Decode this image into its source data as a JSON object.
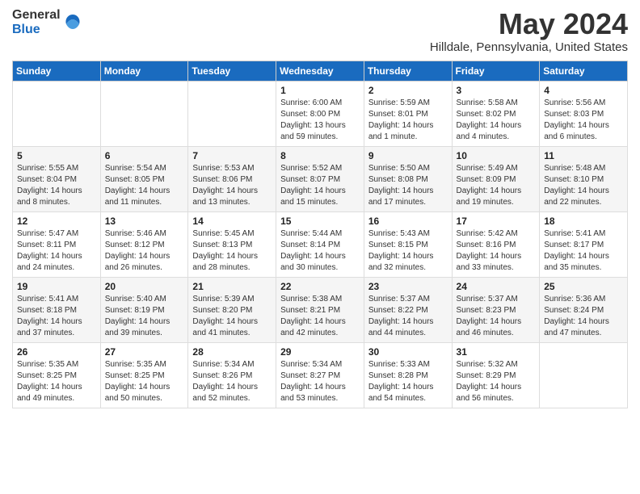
{
  "logo": {
    "general": "General",
    "blue": "Blue"
  },
  "title": "May 2024",
  "subtitle": "Hilldale, Pennsylvania, United States",
  "days_of_week": [
    "Sunday",
    "Monday",
    "Tuesday",
    "Wednesday",
    "Thursday",
    "Friday",
    "Saturday"
  ],
  "weeks": [
    [
      {
        "day": "",
        "info": ""
      },
      {
        "day": "",
        "info": ""
      },
      {
        "day": "",
        "info": ""
      },
      {
        "day": "1",
        "info": "Sunrise: 6:00 AM\nSunset: 8:00 PM\nDaylight: 13 hours\nand 59 minutes."
      },
      {
        "day": "2",
        "info": "Sunrise: 5:59 AM\nSunset: 8:01 PM\nDaylight: 14 hours\nand 1 minute."
      },
      {
        "day": "3",
        "info": "Sunrise: 5:58 AM\nSunset: 8:02 PM\nDaylight: 14 hours\nand 4 minutes."
      },
      {
        "day": "4",
        "info": "Sunrise: 5:56 AM\nSunset: 8:03 PM\nDaylight: 14 hours\nand 6 minutes."
      }
    ],
    [
      {
        "day": "5",
        "info": "Sunrise: 5:55 AM\nSunset: 8:04 PM\nDaylight: 14 hours\nand 8 minutes."
      },
      {
        "day": "6",
        "info": "Sunrise: 5:54 AM\nSunset: 8:05 PM\nDaylight: 14 hours\nand 11 minutes."
      },
      {
        "day": "7",
        "info": "Sunrise: 5:53 AM\nSunset: 8:06 PM\nDaylight: 14 hours\nand 13 minutes."
      },
      {
        "day": "8",
        "info": "Sunrise: 5:52 AM\nSunset: 8:07 PM\nDaylight: 14 hours\nand 15 minutes."
      },
      {
        "day": "9",
        "info": "Sunrise: 5:50 AM\nSunset: 8:08 PM\nDaylight: 14 hours\nand 17 minutes."
      },
      {
        "day": "10",
        "info": "Sunrise: 5:49 AM\nSunset: 8:09 PM\nDaylight: 14 hours\nand 19 minutes."
      },
      {
        "day": "11",
        "info": "Sunrise: 5:48 AM\nSunset: 8:10 PM\nDaylight: 14 hours\nand 22 minutes."
      }
    ],
    [
      {
        "day": "12",
        "info": "Sunrise: 5:47 AM\nSunset: 8:11 PM\nDaylight: 14 hours\nand 24 minutes."
      },
      {
        "day": "13",
        "info": "Sunrise: 5:46 AM\nSunset: 8:12 PM\nDaylight: 14 hours\nand 26 minutes."
      },
      {
        "day": "14",
        "info": "Sunrise: 5:45 AM\nSunset: 8:13 PM\nDaylight: 14 hours\nand 28 minutes."
      },
      {
        "day": "15",
        "info": "Sunrise: 5:44 AM\nSunset: 8:14 PM\nDaylight: 14 hours\nand 30 minutes."
      },
      {
        "day": "16",
        "info": "Sunrise: 5:43 AM\nSunset: 8:15 PM\nDaylight: 14 hours\nand 32 minutes."
      },
      {
        "day": "17",
        "info": "Sunrise: 5:42 AM\nSunset: 8:16 PM\nDaylight: 14 hours\nand 33 minutes."
      },
      {
        "day": "18",
        "info": "Sunrise: 5:41 AM\nSunset: 8:17 PM\nDaylight: 14 hours\nand 35 minutes."
      }
    ],
    [
      {
        "day": "19",
        "info": "Sunrise: 5:41 AM\nSunset: 8:18 PM\nDaylight: 14 hours\nand 37 minutes."
      },
      {
        "day": "20",
        "info": "Sunrise: 5:40 AM\nSunset: 8:19 PM\nDaylight: 14 hours\nand 39 minutes."
      },
      {
        "day": "21",
        "info": "Sunrise: 5:39 AM\nSunset: 8:20 PM\nDaylight: 14 hours\nand 41 minutes."
      },
      {
        "day": "22",
        "info": "Sunrise: 5:38 AM\nSunset: 8:21 PM\nDaylight: 14 hours\nand 42 minutes."
      },
      {
        "day": "23",
        "info": "Sunrise: 5:37 AM\nSunset: 8:22 PM\nDaylight: 14 hours\nand 44 minutes."
      },
      {
        "day": "24",
        "info": "Sunrise: 5:37 AM\nSunset: 8:23 PM\nDaylight: 14 hours\nand 46 minutes."
      },
      {
        "day": "25",
        "info": "Sunrise: 5:36 AM\nSunset: 8:24 PM\nDaylight: 14 hours\nand 47 minutes."
      }
    ],
    [
      {
        "day": "26",
        "info": "Sunrise: 5:35 AM\nSunset: 8:25 PM\nDaylight: 14 hours\nand 49 minutes."
      },
      {
        "day": "27",
        "info": "Sunrise: 5:35 AM\nSunset: 8:25 PM\nDaylight: 14 hours\nand 50 minutes."
      },
      {
        "day": "28",
        "info": "Sunrise: 5:34 AM\nSunset: 8:26 PM\nDaylight: 14 hours\nand 52 minutes."
      },
      {
        "day": "29",
        "info": "Sunrise: 5:34 AM\nSunset: 8:27 PM\nDaylight: 14 hours\nand 53 minutes."
      },
      {
        "day": "30",
        "info": "Sunrise: 5:33 AM\nSunset: 8:28 PM\nDaylight: 14 hours\nand 54 minutes."
      },
      {
        "day": "31",
        "info": "Sunrise: 5:32 AM\nSunset: 8:29 PM\nDaylight: 14 hours\nand 56 minutes."
      },
      {
        "day": "",
        "info": ""
      }
    ]
  ]
}
